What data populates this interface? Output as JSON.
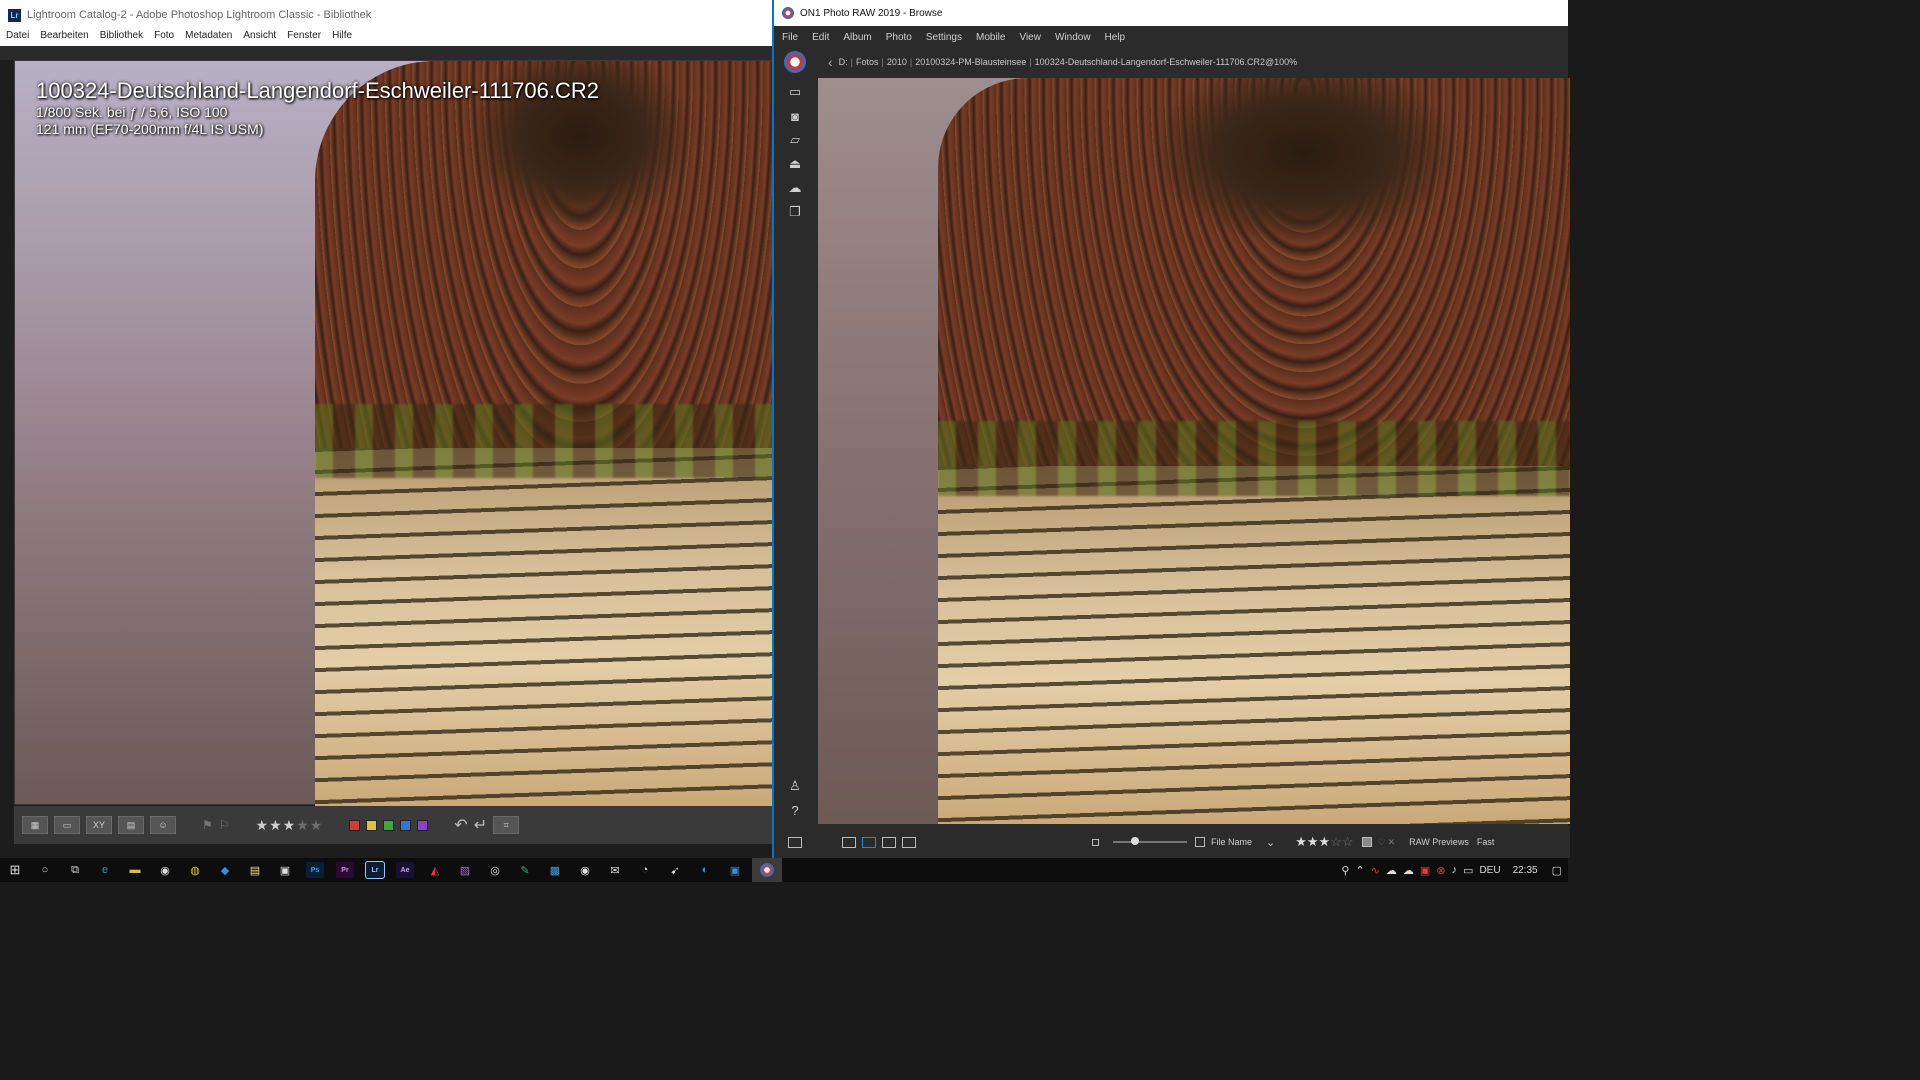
{
  "lightroom": {
    "title": "Lightroom Catalog-2 - Adobe Photoshop Lightroom Classic - Bibliothek",
    "app_badge": "Lr",
    "menu": [
      "Datei",
      "Bearbeiten",
      "Bibliothek",
      "Foto",
      "Metadaten",
      "Ansicht",
      "Fenster",
      "Hilfe"
    ],
    "overlay": {
      "filename": "100324-Deutschland-Langendorf-Eschweiler-111706.CR2",
      "exposure": "1/800 Sek. bei ƒ / 5,6, ISO 100",
      "lens": "121 mm (EF70-200mm f/4L IS USM)"
    },
    "toolbar": {
      "rating_on": "★★★",
      "rating_off": "★★",
      "color_labels": [
        "#d23b3b",
        "#d9c53a",
        "#3aa84a",
        "#3a72d6",
        "#8a44c8"
      ],
      "icons": [
        "grid-view",
        "loupe-view",
        "compare-view",
        "survey-view",
        "people-view",
        "flag-pick",
        "flag-reject",
        "rotate-left",
        "rotate-right",
        "crop-overlay"
      ]
    }
  },
  "on1": {
    "title": "ON1 Photo RAW 2019 - Browse",
    "menu": [
      "File",
      "Edit",
      "Album",
      "Photo",
      "Settings",
      "Mobile",
      "View",
      "Window",
      "Help"
    ],
    "breadcrumb": [
      "D:",
      "Fotos",
      "2010",
      "20100324-PM-Blausteinsee",
      "100324-Deutschland-Langendorf-Eschweiler-111706.CR2@100%"
    ],
    "rail_icons": [
      "monitor-icon",
      "camera-icon",
      "folder-icon",
      "drive-icon",
      "cloud-icon",
      "albums-icon"
    ],
    "rail_bottom_icons": [
      "user-icon",
      "help-icon"
    ],
    "bottombar": {
      "sort_label": "File Name",
      "rating_on": "★★★",
      "rating_off": "☆☆",
      "raw_previews_label": "RAW Previews",
      "raw_previews_value": "Fast"
    }
  },
  "taskbar": {
    "apps": [
      "Ps",
      "Pr",
      "Lr",
      "Ae"
    ],
    "language": "DEU",
    "time": "22:35"
  }
}
